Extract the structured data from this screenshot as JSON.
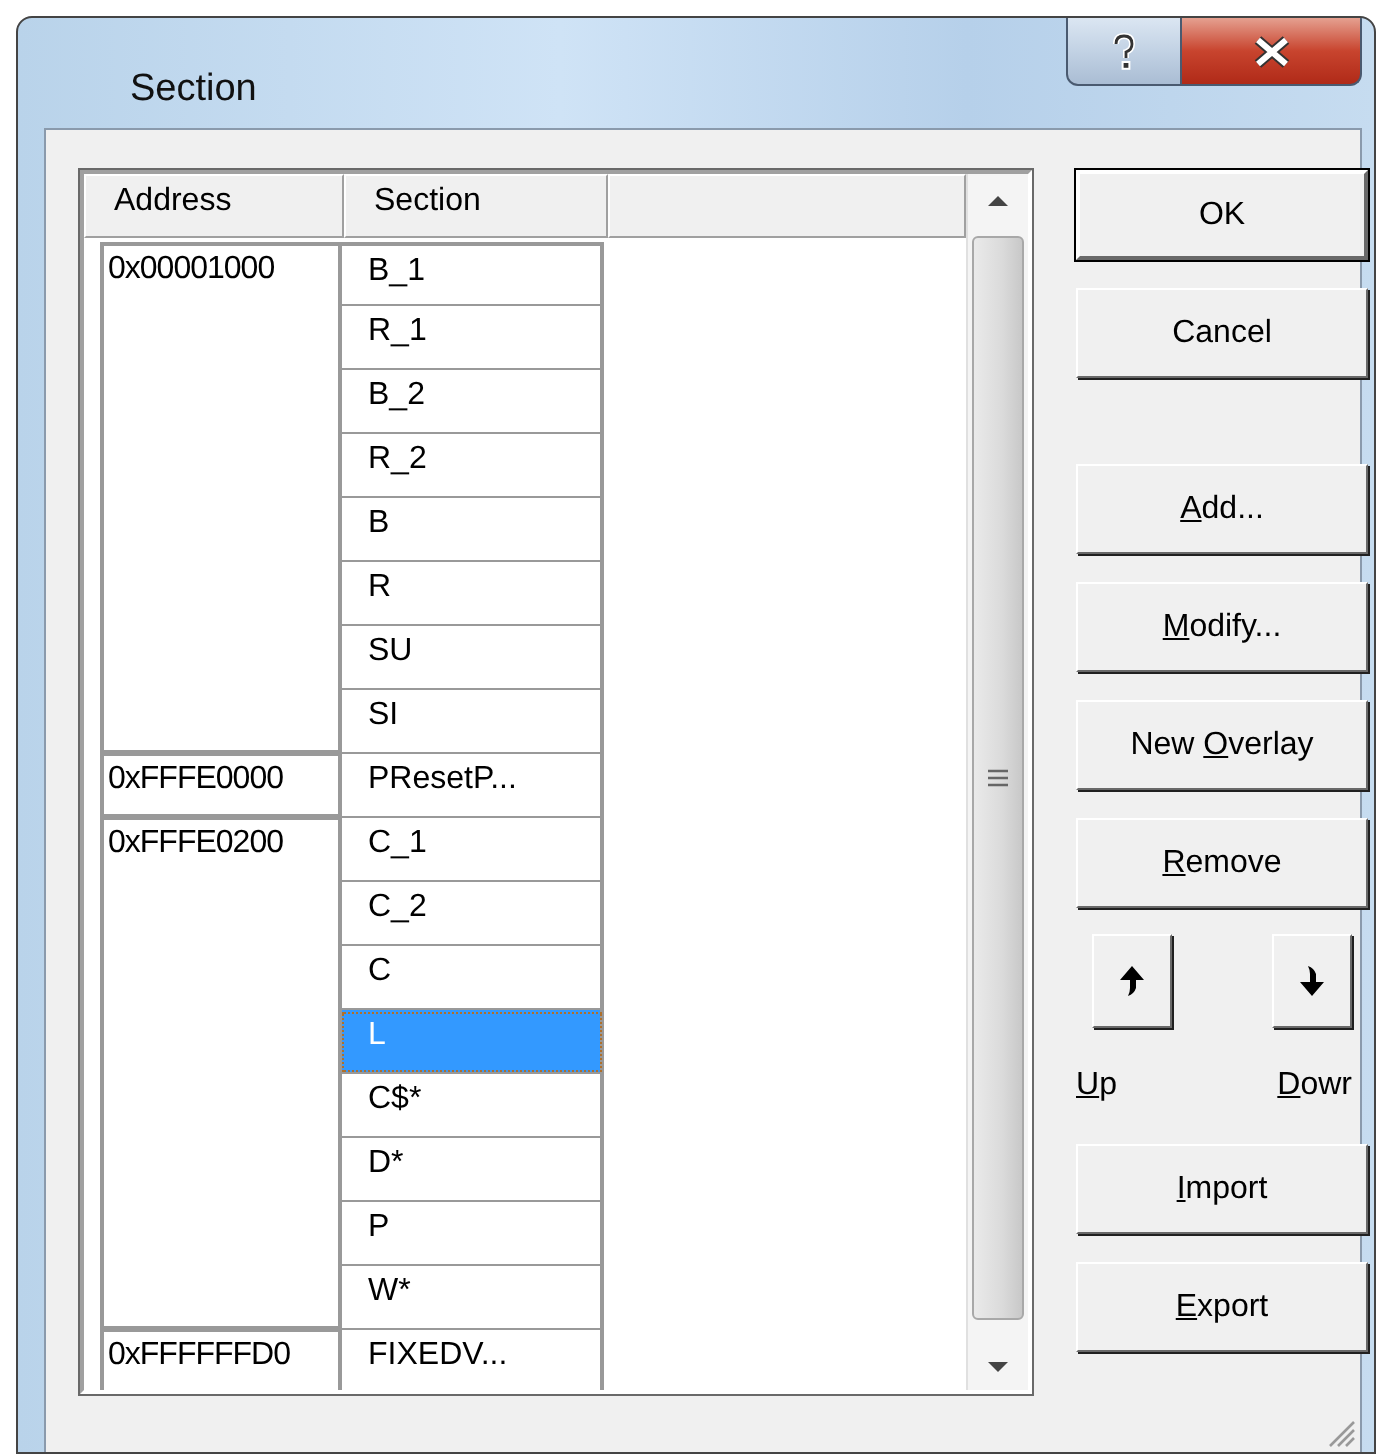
{
  "window": {
    "title": "Section"
  },
  "table": {
    "columns": [
      "Address",
      "Section"
    ],
    "groups": [
      {
        "address": "0x00001000",
        "sections": [
          {
            "name": "B_1",
            "selected": false
          },
          {
            "name": "R_1",
            "selected": false
          },
          {
            "name": "B_2",
            "selected": false
          },
          {
            "name": "R_2",
            "selected": false
          },
          {
            "name": "B",
            "selected": false
          },
          {
            "name": "R",
            "selected": false
          },
          {
            "name": "SU",
            "selected": false
          },
          {
            "name": "SI",
            "selected": false
          }
        ]
      },
      {
        "address": "0xFFFE0000",
        "sections": [
          {
            "name": "PResetP...",
            "selected": false
          }
        ]
      },
      {
        "address": "0xFFFE0200",
        "sections": [
          {
            "name": "C_1",
            "selected": false
          },
          {
            "name": "C_2",
            "selected": false
          },
          {
            "name": "C",
            "selected": false
          },
          {
            "name": "L",
            "selected": true
          },
          {
            "name": "C$*",
            "selected": false
          },
          {
            "name": "D*",
            "selected": false
          },
          {
            "name": "P",
            "selected": false
          },
          {
            "name": "W*",
            "selected": false
          }
        ]
      },
      {
        "address": "0xFFFFFFD0",
        "sections": [
          {
            "name": "FIXEDV...",
            "selected": false
          }
        ]
      }
    ]
  },
  "buttons_top": [
    {
      "rest": "OK",
      "default": true
    },
    {
      "rest": "Cancel",
      "default": false
    }
  ],
  "buttons_edit": [
    {
      "key": "A",
      "rest": "dd...",
      "default": false
    },
    {
      "key": "M",
      "rest": "odify...",
      "default": false
    },
    {
      "lead": "New ",
      "key": "O",
      "rest": "verlay",
      "default": false
    },
    {
      "key": "R",
      "rest": "emove",
      "default": false
    }
  ],
  "move": [
    {
      "kind": "up",
      "key": "U",
      "rest": "p"
    },
    {
      "kind": "down",
      "key": "D",
      "rest": "owr"
    }
  ],
  "buttons_bottom": [
    {
      "key": "I",
      "rest": "mport",
      "default": false
    },
    {
      "key": "E",
      "rest": "xport",
      "default": false
    }
  ]
}
